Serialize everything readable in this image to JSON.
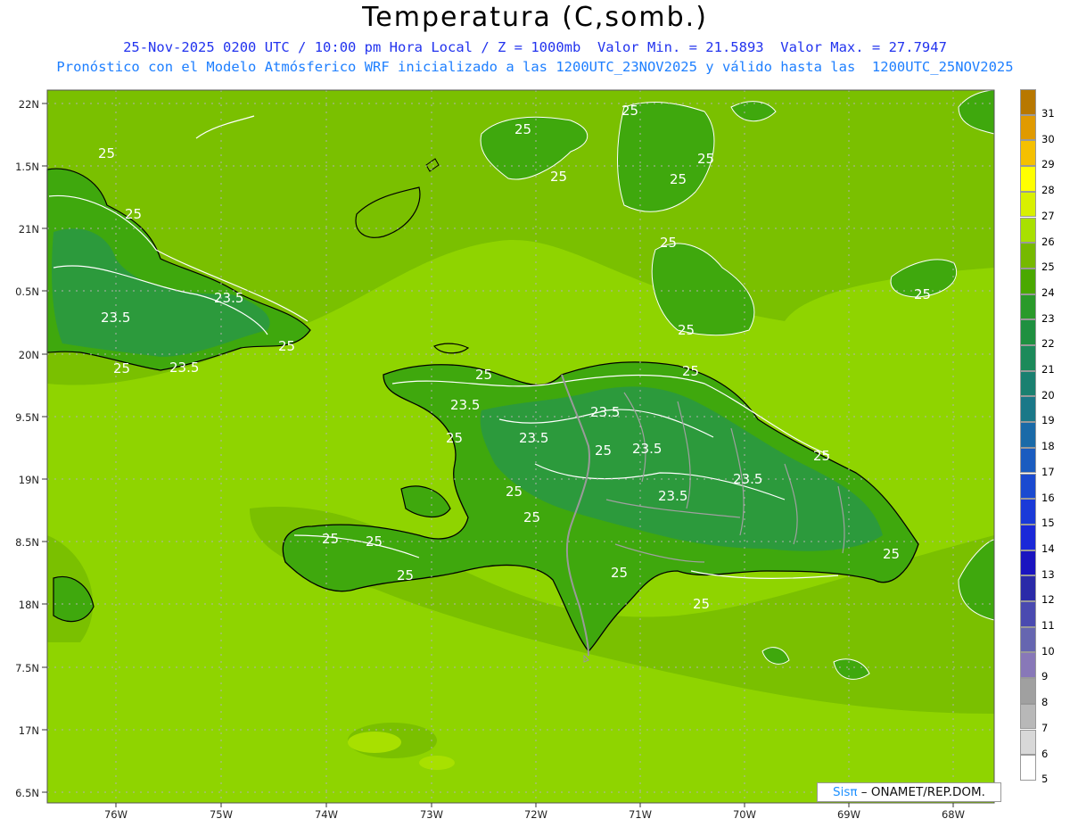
{
  "title": "Temperatura (C,somb.)",
  "subtitle_line1": "25-Nov-2025 0200 UTC / 10:00 pm Hora Local / Z = 1000mb  Valor Min. = 21.5893  Valor Max. = 27.7947",
  "subtitle_line2": "Pronóstico con el Modelo Atmósferico WRF inicializado a las 1200UTC_23NOV2025 y válido hasta las  1200UTC_25NOV2025",
  "footer": {
    "brand": "Sisπ",
    "org": " ONAMET/REP.DOM."
  },
  "lat_labels": [
    "22N",
    "1.5N",
    "21N",
    "0.5N",
    "20N",
    "9.5N",
    "19N",
    "8.5N",
    "18N",
    "7.5N",
    "17N",
    "6.5N"
  ],
  "lon_labels": [
    "76W",
    "75W",
    "74W",
    "73W",
    "72W",
    "71W",
    "70W",
    "69W",
    "68W"
  ],
  "colorbar": {
    "labels": [
      "31",
      "30",
      "29",
      "28",
      "27",
      "26",
      "25",
      "24",
      "23",
      "22",
      "21",
      "20",
      "19",
      "18",
      "17",
      "16",
      "15",
      "14",
      "13",
      "12",
      "11",
      "10",
      "9",
      "8",
      "7",
      "6",
      "5"
    ],
    "colors": [
      "#b87800",
      "#e09a00",
      "#f5c000",
      "#ffff00",
      "#d8f000",
      "#a8e000",
      "#76b900",
      "#4aa800",
      "#2a9a2a",
      "#1f9040",
      "#1c8a5a",
      "#1a8070",
      "#1a7888",
      "#1a6aa8",
      "#1a5cc0",
      "#1a4ad0",
      "#1a3ad8",
      "#1a28d8",
      "#1a14c0",
      "#2a2aa8",
      "#4a4ab0",
      "#6666b0",
      "#8878b8",
      "#a0a0a0",
      "#b8b8b8",
      "#d8d8d8",
      "#ffffff"
    ]
  },
  "map_colors": {
    "sea": "#8fd400",
    "sea_dark": "#7ac000",
    "land_25": "#74b800",
    "land_24": "#3fa80d",
    "land_23": "#2c9a3c"
  },
  "contour_labels": [
    "25",
    "25",
    "25",
    "25",
    "25",
    "25",
    "25",
    "25",
    "25",
    "25",
    "25",
    "25",
    "25",
    "25",
    "25",
    "25",
    "25",
    "25",
    "25",
    "25",
    "25",
    "25",
    "23.5",
    "23.5",
    "23.5",
    "23.5",
    "23.5",
    "23.5",
    "23.5",
    "23.5",
    "23.5",
    "25",
    "25",
    "25"
  ]
}
